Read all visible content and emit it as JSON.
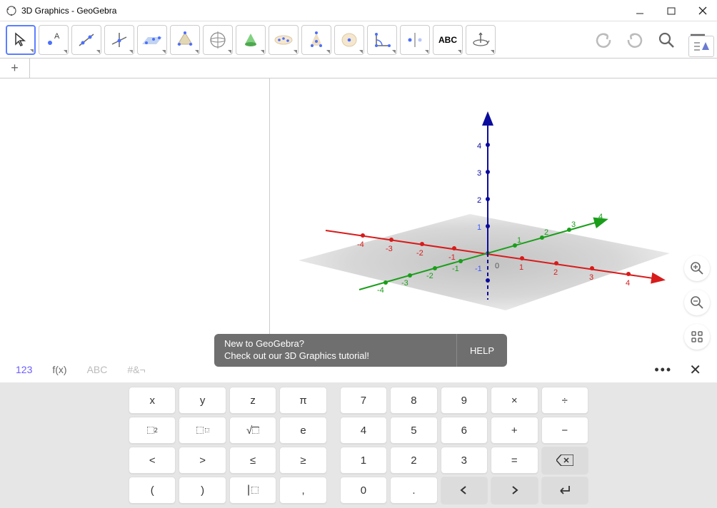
{
  "window": {
    "title": "3D Graphics - GeoGebra"
  },
  "toolbar": {
    "tools": [
      "move",
      "point",
      "line",
      "perp",
      "plane",
      "pyramid",
      "sphere",
      "net",
      "intersect",
      "circle-point",
      "angle",
      "reflect",
      "text",
      "rotate-view"
    ],
    "text_label": "ABC"
  },
  "popup": {
    "line1": "New to GeoGebra?",
    "line2": "Check out our 3D Graphics tutorial!",
    "help": "HELP"
  },
  "keyboard": {
    "tabs": {
      "t1": "123",
      "t2": "f(x)",
      "t3": "ABC",
      "t4": "#&¬"
    },
    "rows": [
      [
        "x",
        "y",
        "z",
        "π",
        "7",
        "8",
        "9",
        "×",
        "÷"
      ],
      [
        "▫²",
        "▫ᶦ",
        "√▫",
        "e",
        "4",
        "5",
        "6",
        "+",
        "−"
      ],
      [
        "<",
        ">",
        "≤",
        "≥",
        "1",
        "2",
        "3",
        "=",
        "⌫"
      ],
      [
        "(",
        ")",
        "⌷",
        ",",
        "0",
        ".",
        "◂",
        "▸",
        "↵"
      ]
    ]
  },
  "axes": {
    "x": {
      "ticks": [
        "-4",
        "-3",
        "-2",
        "-1",
        "1",
        "2",
        "3",
        "4"
      ],
      "color": "#d81b1b"
    },
    "y": {
      "ticks": [
        "-4",
        "-3",
        "-2",
        "-1",
        "1",
        "2",
        "3",
        "4"
      ],
      "color": "#1a9e1a"
    },
    "z": {
      "ticks": [
        "-1",
        "1",
        "2",
        "3",
        "4"
      ],
      "color": "#0b0b9e"
    },
    "origin": "0"
  }
}
